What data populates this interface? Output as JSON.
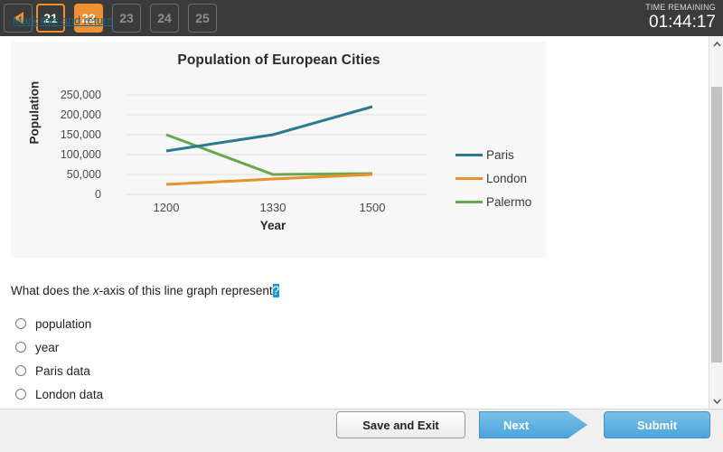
{
  "topbar": {
    "back_button": "back-arrow",
    "question_nav": [
      {
        "label": "21",
        "state": "current"
      },
      {
        "label": "22",
        "state": "active"
      },
      {
        "label": "23",
        "state": "disabled"
      },
      {
        "label": "24",
        "state": "disabled"
      },
      {
        "label": "25",
        "state": "disabled"
      }
    ],
    "timer_label": "TIME REMAINING",
    "timer_value": "01:44:17",
    "accent_color": "#ef9033",
    "background_color": "#3b3b3b"
  },
  "chart_data": {
    "type": "line",
    "title": "Population of European Cities",
    "xlabel": "Year",
    "ylabel": "Population",
    "x": [
      1200,
      1330,
      1500
    ],
    "xtick_labels": [
      "1200",
      "1330",
      "1500"
    ],
    "ytick_labels": [
      "250,000",
      "200,000",
      "150,000",
      "100,000",
      "50,000",
      "0"
    ],
    "ylim": [
      0,
      250000
    ],
    "ytick_values": [
      250000,
      200000,
      150000,
      100000,
      50000,
      0
    ],
    "grid": true,
    "legend_position": "right",
    "series": [
      {
        "name": "Paris",
        "values": [
          110000,
          150000,
          220000
        ],
        "color": "#2b7a8f"
      },
      {
        "name": "London",
        "values": [
          25000,
          40000,
          50000
        ],
        "color": "#e8922e"
      },
      {
        "name": "Palermo",
        "values": [
          150000,
          50000,
          51000
        ],
        "color": "#6aa84f"
      }
    ]
  },
  "question": {
    "text_before": "What does the ",
    "italic_text": "x",
    "text_middle": "-axis of this line graph represent",
    "highlighted_mark": "?"
  },
  "options": [
    {
      "label": "population",
      "selected": false
    },
    {
      "label": "year",
      "selected": false
    },
    {
      "label": "Paris data",
      "selected": false
    },
    {
      "label": "London data",
      "selected": false
    }
  ],
  "scrollbar": {
    "up_arrow": "chevron-up-icon",
    "down_arrow": "chevron-down-icon"
  },
  "bottombar": {
    "mark_link": "Mark this and return",
    "save_label": "Save and Exit",
    "next_label": "Next",
    "submit_label": "Submit",
    "button_color": "#4da5db"
  }
}
